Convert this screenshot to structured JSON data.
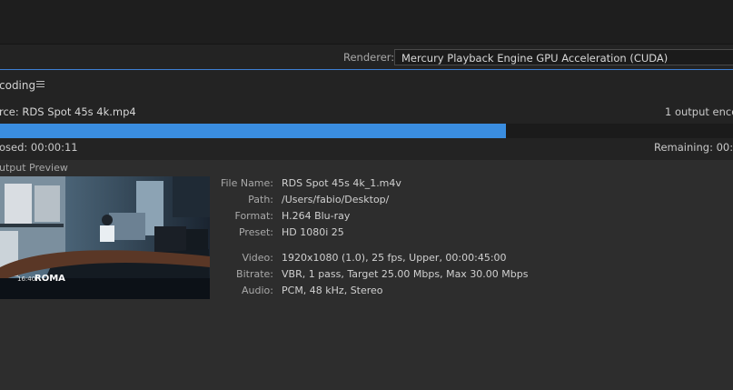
{
  "renderer": {
    "label": "Renderer:",
    "value": "Mercury Playback Engine GPU Acceleration (CUDA)"
  },
  "encoding": {
    "title": "coding",
    "menu_icon": "hamburger-menu-icon",
    "source": "rce: RDS Spot 45s 4k.mp4",
    "output_count": "1 output encod",
    "progress_fraction": 0.69,
    "elapsed": "osed: 00:00:11",
    "remaining": "Remaining: 00:00"
  },
  "preview": {
    "label": "utput Preview",
    "overlay_small": "16:40",
    "overlay_text": "ROMA"
  },
  "details": [
    {
      "label": "File Name:",
      "value": "RDS Spot 45s 4k_1.m4v"
    },
    {
      "label": "Path:",
      "value": "/Users/fabio/Desktop/"
    },
    {
      "label": "Format:",
      "value": "H.264 Blu-ray"
    },
    {
      "label": "Preset:",
      "value": "HD 1080i 25"
    },
    {
      "label": "Video:",
      "value": "1920x1080 (1.0), 25 fps, Upper, 00:00:45:00"
    },
    {
      "label": "Bitrate:",
      "value": "VBR, 1 pass, Target 25.00 Mbps, Max 30.00 Mbps"
    },
    {
      "label": "Audio:",
      "value": "PCM, 48 kHz, Stereo"
    }
  ],
  "colors": {
    "accent": "#3a8de0",
    "background": "#232323",
    "panel": "#2d2d2d"
  }
}
